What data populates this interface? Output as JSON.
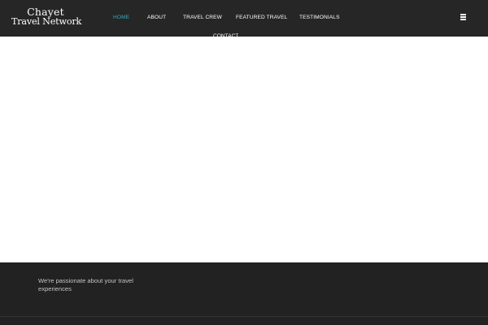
{
  "header": {
    "logo_line1": "Chayet",
    "logo_line2": "Travel Network",
    "nav": [
      {
        "label": "HOME",
        "active": true
      },
      {
        "label": "ABOUT",
        "active": false
      },
      {
        "label": "TRAVEL CREW",
        "active": false
      },
      {
        "label": "FEATURED TRAVEL",
        "active": false
      },
      {
        "label": "TESTIMONIALS",
        "active": false
      },
      {
        "label": "CONTACT",
        "active": false
      }
    ],
    "menu_icon": "hamburger-menu-icon",
    "active_color": "#39a6c2"
  },
  "footer": {
    "tagline": "We're passionate about your travel experiences"
  }
}
